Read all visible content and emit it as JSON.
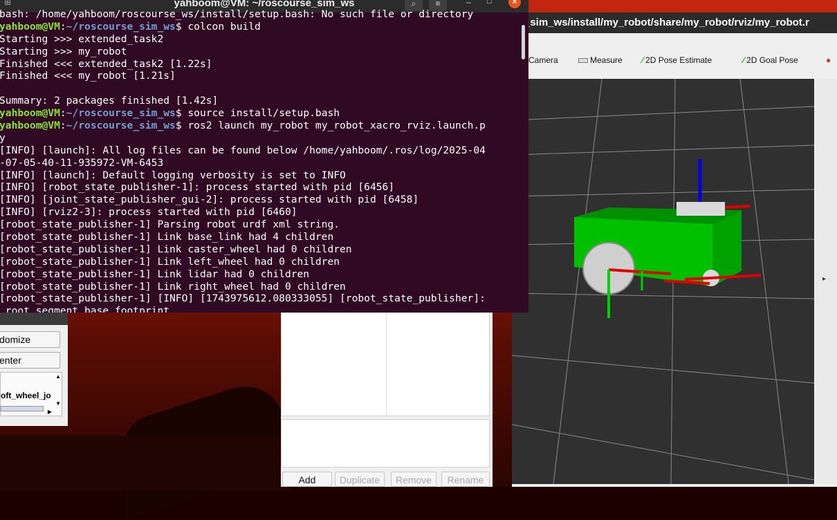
{
  "terminal": {
    "title": "yahboom@VM: ~/roscourse_sim_ws",
    "lines": [
      [
        {
          "t": "bash: /home/yahboom/roscourse_ws/install/setup.bash: No such file or directory",
          "c": ""
        }
      ],
      [
        {
          "t": "yahboom@VM",
          "c": "g"
        },
        {
          "t": ":",
          "c": ""
        },
        {
          "t": "~/roscourse_sim_ws",
          "c": "b"
        },
        {
          "t": "$ colcon build",
          "c": ""
        }
      ],
      [
        {
          "t": "Starting >>> extended_task2",
          "c": ""
        }
      ],
      [
        {
          "t": "Starting >>> my_robot",
          "c": ""
        }
      ],
      [
        {
          "t": "Finished <<< extended_task2 [1.22s]",
          "c": ""
        }
      ],
      [
        {
          "t": "Finished <<< my_robot [1.21s]",
          "c": ""
        }
      ],
      [
        {
          "t": "",
          "c": ""
        }
      ],
      [
        {
          "t": "Summary: 2 packages finished [1.42s]",
          "c": ""
        }
      ],
      [
        {
          "t": "yahboom@VM",
          "c": "g"
        },
        {
          "t": ":",
          "c": ""
        },
        {
          "t": "~/roscourse_sim_ws",
          "c": "b"
        },
        {
          "t": "$ source install/setup.bash",
          "c": ""
        }
      ],
      [
        {
          "t": "yahboom@VM",
          "c": "g"
        },
        {
          "t": ":",
          "c": ""
        },
        {
          "t": "~/roscourse_sim_ws",
          "c": "b"
        },
        {
          "t": "$ ros2 launch my_robot my_robot_xacro_rviz.launch.p",
          "c": ""
        }
      ],
      [
        {
          "t": "y",
          "c": ""
        }
      ],
      [
        {
          "t": "[INFO] [launch]: All log files can be found below /home/yahboom/.ros/log/2025-04",
          "c": ""
        }
      ],
      [
        {
          "t": "-07-05-40-11-935972-VM-6453",
          "c": ""
        }
      ],
      [
        {
          "t": "[INFO] [launch]: Default logging verbosity is set to INFO",
          "c": ""
        }
      ],
      [
        {
          "t": "[INFO] [robot_state_publisher-1]: process started with pid [6456]",
          "c": ""
        }
      ],
      [
        {
          "t": "[INFO] [joint_state_publisher_gui-2]: process started with pid [6458]",
          "c": ""
        }
      ],
      [
        {
          "t": "[INFO] [rviz2-3]: process started with pid [6460]",
          "c": ""
        }
      ],
      [
        {
          "t": "[robot_state_publisher-1] Parsing robot urdf xml string.",
          "c": ""
        }
      ],
      [
        {
          "t": "[robot_state_publisher-1] Link base_link had 4 children",
          "c": ""
        }
      ],
      [
        {
          "t": "[robot_state_publisher-1] Link caster_wheel had 0 children",
          "c": ""
        }
      ],
      [
        {
          "t": "[robot_state_publisher-1] Link left_wheel had 0 children",
          "c": ""
        }
      ],
      [
        {
          "t": "[robot_state_publisher-1] Link lidar had 0 children",
          "c": ""
        }
      ],
      [
        {
          "t": "[robot_state_publisher-1] Link right_wheel had 0 children",
          "c": ""
        }
      ],
      [
        {
          "t": "[robot_state_publisher-1] [INFO] [1743975612.080333055] [robot_state_publisher]:",
          "c": ""
        }
      ],
      [
        {
          "t": " root segment base_footprint",
          "c": ""
        }
      ]
    ]
  },
  "rviz": {
    "title_path": "_sim_ws/install/my_robot/share/my_robot/rviz/my_robot.r",
    "toolbar": {
      "camera": "Camera",
      "measure": "Measure",
      "pose_estimate": "2D Pose Estimate",
      "goal_pose": "2D Goal Pose"
    },
    "side_arrow": "▸"
  },
  "panel": {
    "add": "Add",
    "duplicate": "Duplicate",
    "remove": "Remove",
    "rename": "Rename"
  },
  "jsp": {
    "randomize": "domize",
    "center": "enter",
    "joint_label": "oft_wheel_jo"
  },
  "colors": {
    "terminal_bg": "#300a24",
    "prompt_user": "#8ae234",
    "prompt_path": "#729fcf",
    "robot_body": "#00c000"
  }
}
